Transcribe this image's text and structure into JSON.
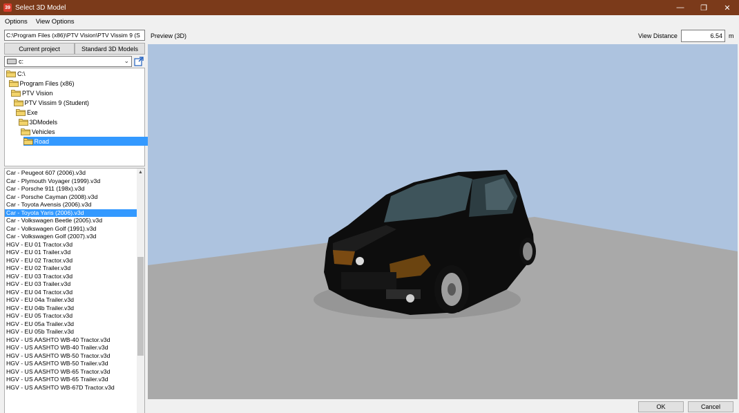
{
  "window": {
    "app_icon": "39",
    "title": "Select 3D Model",
    "controls": {
      "minimize": "—",
      "restore": "❐",
      "close": "✕"
    }
  },
  "menu": [
    "Options",
    "View Options"
  ],
  "left": {
    "path": "C:\\Program Files (x86)\\PTV Vision\\PTV Vissim 9 (S",
    "tabs": [
      "Current project",
      "Standard 3D Models"
    ],
    "drive": "c:",
    "tree": [
      {
        "label": "C:\\",
        "depth": 0
      },
      {
        "label": "Program Files (x86)",
        "depth": 1
      },
      {
        "label": "PTV Vision",
        "depth": 2
      },
      {
        "label": "PTV Vissim 9 (Student)",
        "depth": 3
      },
      {
        "label": "Exe",
        "depth": 4
      },
      {
        "label": "3DModels",
        "depth": 5
      },
      {
        "label": "Vehicles",
        "depth": 6
      },
      {
        "label": "Road",
        "depth": 7,
        "selected": true
      }
    ],
    "files": [
      "Car - Peugeot 607 (2006).v3d",
      "Car - Plymouth Voyager (1999).v3d",
      "Car - Porsche 911 (198x).v3d",
      "Car - Porsche Cayman (2008).v3d",
      "Car - Toyota Avensis (2006).v3d",
      "Car - Toyota Yaris (2006).v3d",
      "Car - Volkswagen Beetle (2005).v3d",
      "Car - Volkswagen Golf (1991).v3d",
      "Car - Volkswagen Golf (2007).v3d",
      "HGV - EU 01 Tractor.v3d",
      "HGV - EU 01 Trailer.v3d",
      "HGV - EU 02 Tractor.v3d",
      "HGV - EU 02 Trailer.v3d",
      "HGV - EU 03 Tractor.v3d",
      "HGV - EU 03 Trailer.v3d",
      "HGV - EU 04 Tractor.v3d",
      "HGV - EU 04a Trailer.v3d",
      "HGV - EU 04b Trailer.v3d",
      "HGV - EU 05 Tractor.v3d",
      "HGV - EU 05a Trailer.v3d",
      "HGV - EU 05b Trailer.v3d",
      "HGV - US AASHTO WB-40 Tractor.v3d",
      "HGV - US AASHTO WB-40 Trailer.v3d",
      "HGV - US AASHTO WB-50 Tractor.v3d",
      "HGV - US AASHTO WB-50 Trailer.v3d",
      "HGV - US AASHTO WB-65 Tractor.v3d",
      "HGV - US AASHTO WB-65 Trailer.v3d",
      "HGV - US AASHTO WB-67D Tractor.v3d"
    ],
    "selected_file_index": 5,
    "scroll_up": "▲",
    "scroll_down": "▼"
  },
  "preview": {
    "label": "Preview (3D)",
    "view_distance_label": "View Distance",
    "view_distance_value": "6.54",
    "view_distance_unit": "m",
    "colors": {
      "sky": "#adc3df",
      "ground": "#a9a9a9",
      "car": "#0d0d0d"
    }
  },
  "footer": {
    "ok": "OK",
    "cancel": "Cancel"
  },
  "colors": {
    "titlebar": "#7b3a1a",
    "selection": "#3399ff"
  }
}
